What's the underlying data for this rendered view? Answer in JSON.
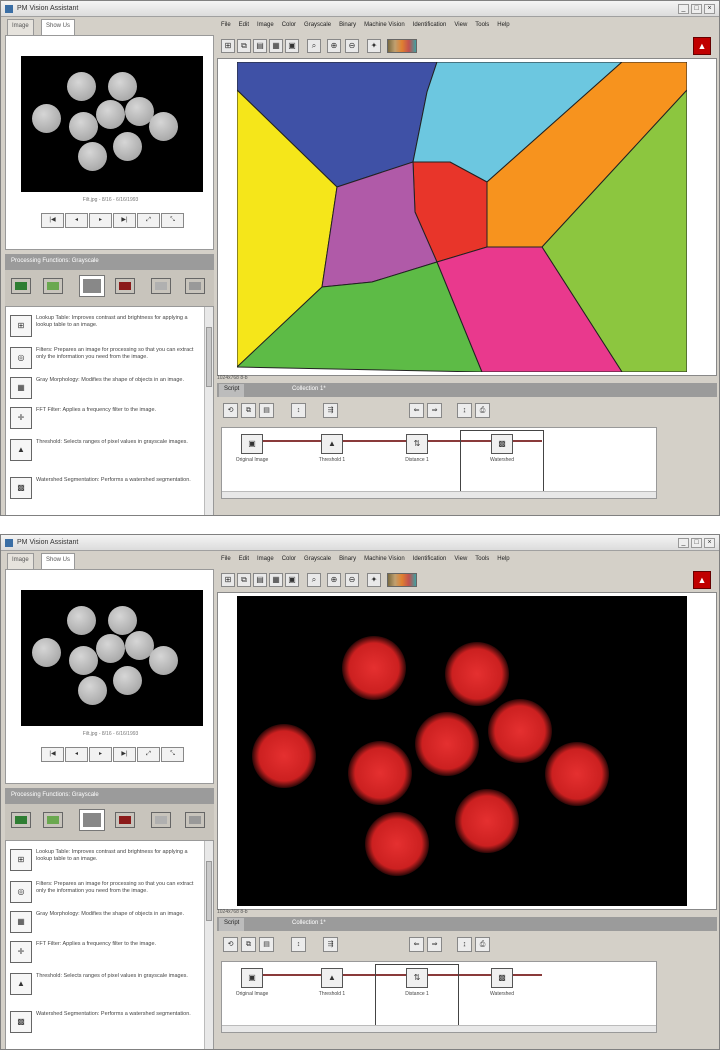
{
  "app": {
    "title": "PM Vision Assistant"
  },
  "windows": [
    {
      "tabs": [
        "Image",
        "Show Us"
      ],
      "thumb_caption": "Filt.jpg - 8/16 - 6/16/1993",
      "playback": [
        "|◀",
        "◂",
        "▸",
        "▶|",
        "⤢",
        "⤡"
      ],
      "section_bar": "Processing Functions: Grayscale",
      "functions": [
        {
          "icon": "lookup-table-icon",
          "glyph": "⊞",
          "text": "Lookup Table: Improves contrast and brightness for applying a lookup table to an image."
        },
        {
          "icon": "filter-icon",
          "glyph": "◎",
          "text": "Filters: Prepares an image for processing so that you can extract only the information you need from the image."
        },
        {
          "icon": "morphology-icon",
          "glyph": "▦",
          "text": "Gray Morphology: Modifies the shape of objects in an image."
        },
        {
          "icon": "fft-filter-icon",
          "glyph": "✛",
          "text": "FFT Filter: Applies a frequency filter to the image."
        },
        {
          "icon": "threshold-icon",
          "glyph": "▲",
          "text": "Threshold: Selects ranges of pixel values in grayscale images."
        },
        {
          "icon": "watershed-icon",
          "glyph": "▩",
          "text": "Watershed Segmentation: Performs a watershed segmentation."
        }
      ],
      "menu": [
        "File",
        "Edit",
        "Image",
        "Color",
        "Grayscale",
        "Binary",
        "Machine Vision",
        "Identification",
        "View",
        "Tools",
        "Help"
      ],
      "status": "1024x768 8-b",
      "script_tabs": [
        "Script",
        "Collection 1*"
      ],
      "steps": [
        {
          "label": "Original Image",
          "icon": "original-image-icon",
          "glyph": "▣"
        },
        {
          "label": "Threshold 1",
          "icon": "threshold-step-icon",
          "glyph": "▲"
        },
        {
          "label": "Distance 1",
          "icon": "distance-step-icon",
          "glyph": "⇅"
        },
        {
          "label": "Watershed",
          "icon": "watershed-step-icon",
          "glyph": "▩"
        }
      ],
      "selected_step": 3,
      "display": "watershed"
    },
    {
      "tabs": [
        "Image",
        "Show Us"
      ],
      "thumb_caption": "Filt.jpg - 8/16 - 6/16/1993",
      "playback": [
        "|◀",
        "◂",
        "▸",
        "▶|",
        "⤢",
        "⤡"
      ],
      "section_bar": "Processing Functions: Grayscale",
      "functions": [
        {
          "icon": "lookup-table-icon",
          "glyph": "⊞",
          "text": "Lookup Table: Improves contrast and brightness for applying a lookup table to an image."
        },
        {
          "icon": "filter-icon",
          "glyph": "◎",
          "text": "Filters: Prepares an image for processing so that you can extract only the information you need from the image."
        },
        {
          "icon": "morphology-icon",
          "glyph": "▦",
          "text": "Gray Morphology: Modifies the shape of objects in an image."
        },
        {
          "icon": "fft-filter-icon",
          "glyph": "✛",
          "text": "FFT Filter: Applies a frequency filter to the image."
        },
        {
          "icon": "threshold-icon",
          "glyph": "▲",
          "text": "Threshold: Selects ranges of pixel values in grayscale images."
        },
        {
          "icon": "watershed-icon",
          "glyph": "▩",
          "text": "Watershed Segmentation: Performs a watershed segmentation."
        }
      ],
      "menu": [
        "File",
        "Edit",
        "Image",
        "Color",
        "Grayscale",
        "Binary",
        "Machine Vision",
        "Identification",
        "View",
        "Tools",
        "Help"
      ],
      "status": "1024x768 8-b",
      "script_tabs": [
        "Script",
        "Collection 1*"
      ],
      "steps": [
        {
          "label": "Original Image",
          "icon": "original-image-icon",
          "glyph": "▣"
        },
        {
          "label": "Threshold 1",
          "icon": "threshold-step-icon",
          "glyph": "▲"
        },
        {
          "label": "Distance 1",
          "icon": "distance-step-icon",
          "glyph": "⇅"
        },
        {
          "label": "Watershed",
          "icon": "watershed-step-icon",
          "glyph": "▩"
        }
      ],
      "selected_step": 2,
      "display": "distance"
    }
  ],
  "colors": {
    "watershed_regions": [
      "#3f51a6",
      "#6cc7e0",
      "#f7931e",
      "#f5e61a",
      "#e8352a",
      "#b05aa8",
      "#8cc63f",
      "#5dbb46",
      "#e9398d"
    ],
    "distance_blob": "#e53030",
    "logo": "#c00000"
  }
}
